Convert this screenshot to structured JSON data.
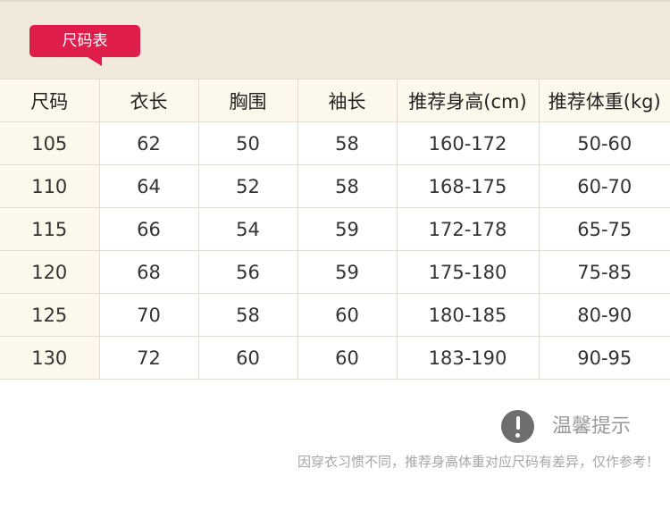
{
  "badge": {
    "label": "尺码表"
  },
  "table": {
    "headers": [
      "尺码",
      "衣长",
      "胸围",
      "袖长",
      "推荐身高(cm)",
      "推荐体重(kg)"
    ],
    "rows": [
      [
        "105",
        "62",
        "50",
        "58",
        "160-172",
        "50-60"
      ],
      [
        "110",
        "64",
        "52",
        "58",
        "168-175",
        "60-70"
      ],
      [
        "115",
        "66",
        "54",
        "59",
        "172-178",
        "65-75"
      ],
      [
        "120",
        "68",
        "56",
        "59",
        "175-180",
        "75-85"
      ],
      [
        "125",
        "70",
        "58",
        "60",
        "180-185",
        "80-90"
      ],
      [
        "130",
        "72",
        "60",
        "60",
        "183-190",
        "90-95"
      ]
    ]
  },
  "tip": {
    "icon": "exclamation-icon",
    "title": "温馨提示",
    "note": "因穿衣习惯不同，推荐身高体重对应尺码有差异，仅作参考！"
  },
  "colors": {
    "accent": "#df1d4a",
    "band": "#f1e9dc",
    "header_bg": "#fdf8ec"
  }
}
